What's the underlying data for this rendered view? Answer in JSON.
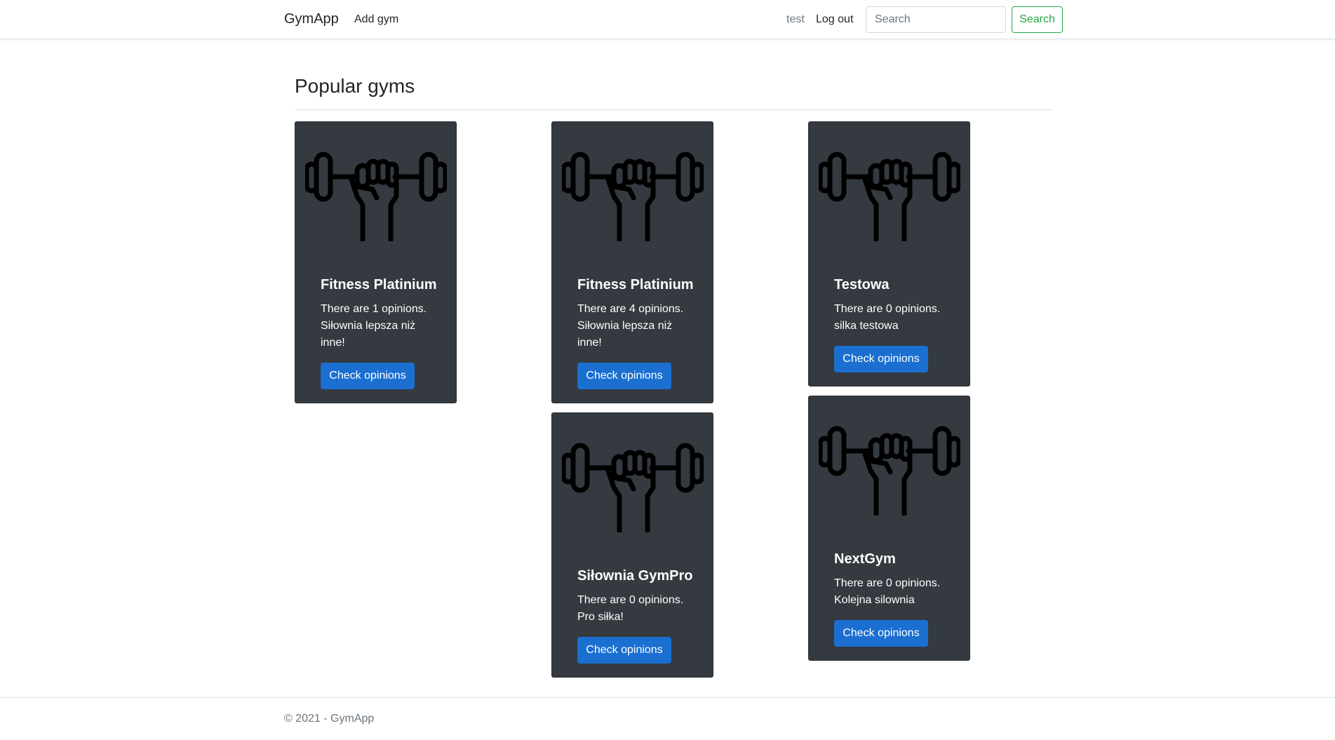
{
  "navbar": {
    "brand": "GymApp",
    "add_gym": "Add gym",
    "username": "test",
    "logout": "Log out",
    "search_placeholder": "Search",
    "search_button": "Search"
  },
  "page_title": "Popular gyms",
  "icon": "dumbbell-fist-icon",
  "colors": {
    "card_bg": "#343a40",
    "primary_button": "#1a6fd1",
    "search_outline": "#28a745"
  },
  "gyms": [
    {
      "name": "Fitness Platinium",
      "opinions": "There are 1 opinions.",
      "description": "Siłownia lepsza niż inne!",
      "button": "Check opinions"
    },
    {
      "name": "Fitness Platinium",
      "opinions": "There are 4 opinions.",
      "description": "Siłownia lepsza niż inne!",
      "button": "Check opinions"
    },
    {
      "name": "Testowa",
      "opinions": "There are 0 opinions.",
      "description": "silka testowa",
      "button": "Check opinions"
    },
    {
      "name": "Siłownia GymPro",
      "opinions": "There are 0 opinions.",
      "description": "Pro siłka!",
      "button": "Check opinions"
    },
    {
      "name": "NextGym",
      "opinions": "There are 0 opinions.",
      "description": "Kolejna silownia",
      "button": "Check opinions"
    }
  ],
  "footer": "© 2021 - GymApp"
}
